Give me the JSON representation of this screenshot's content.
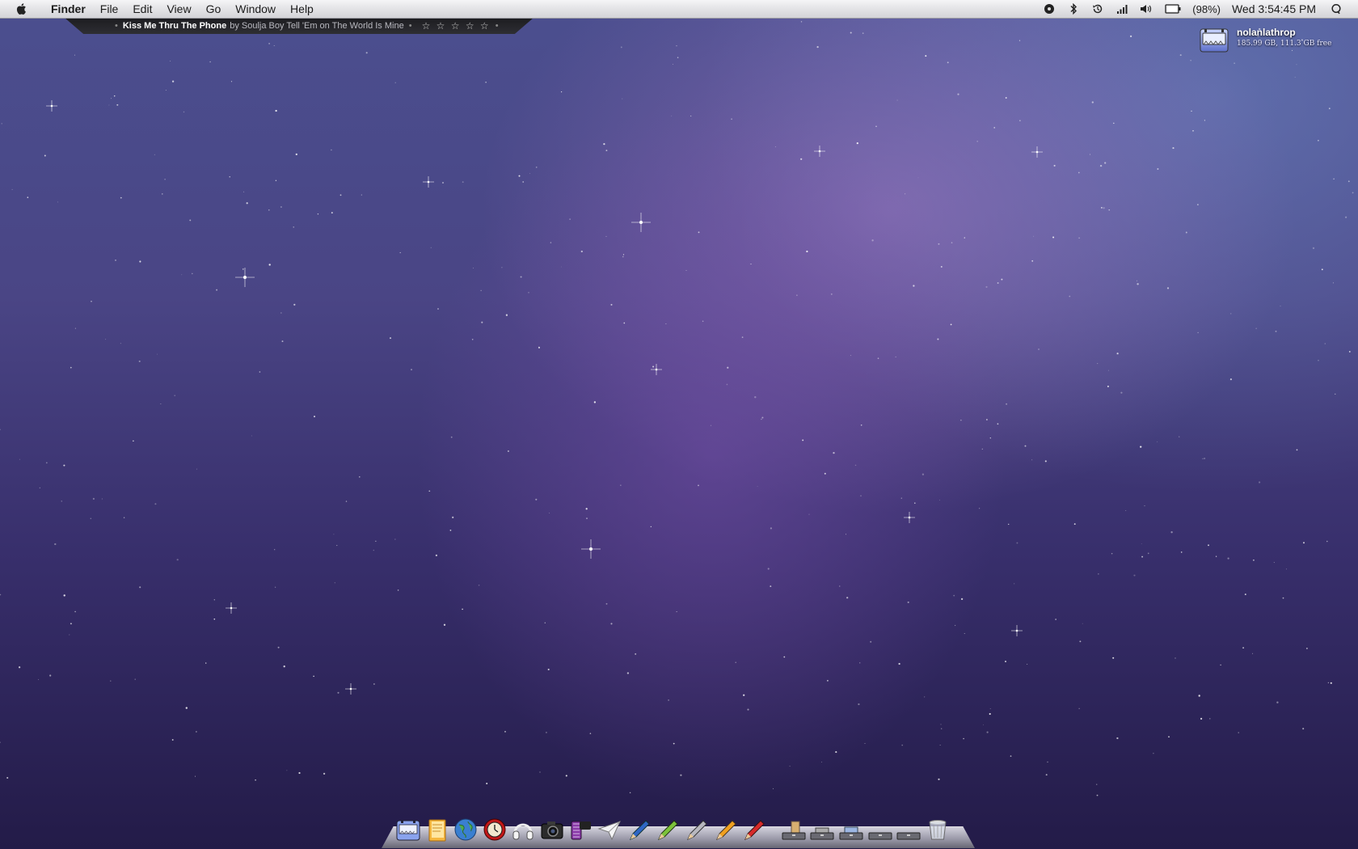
{
  "menubar": {
    "app_name": "Finder",
    "menus": [
      "File",
      "Edit",
      "View",
      "Go",
      "Window",
      "Help"
    ],
    "status": {
      "battery_text": "(98%)",
      "clock": "Wed 3:54:45 PM",
      "icons": [
        "media-icon",
        "bluetooth-icon",
        "time-machine-icon",
        "wifi-signal-icon",
        "volume-icon",
        "battery-icon",
        "spotlight-icon"
      ]
    }
  },
  "now_playing": {
    "title": "Kiss Me Thru The Phone",
    "by_text": "by Soulja Boy Tell 'Em on The World Is Mine",
    "rating_stars": "☆ ☆ ☆ ☆ ☆",
    "separator": "•"
  },
  "desktop_drive": {
    "name": "nolanlathrop",
    "info": "185.99 GB, 111.3 GB free"
  },
  "dock": {
    "apps": [
      "finder-icon",
      "notes-icon",
      "globe-icon",
      "clock-icon",
      "headphones-icon",
      "camera-icon",
      "film-icon",
      "paper-plane-icon",
      "blue-pencil-icon",
      "green-pencil-icon",
      "gray-pencil-icon",
      "orange-pencil-icon",
      "red-pencil-icon"
    ],
    "stacks": [
      "stack-1-icon",
      "stack-2-icon",
      "stack-3-icon",
      "stack-4-icon",
      "stack-5-icon",
      "trash-icon"
    ]
  },
  "colors": {
    "menubar_bg": "#e3e3e6",
    "desktop_top": "#4b4f8f",
    "desktop_bottom": "#231b48"
  }
}
